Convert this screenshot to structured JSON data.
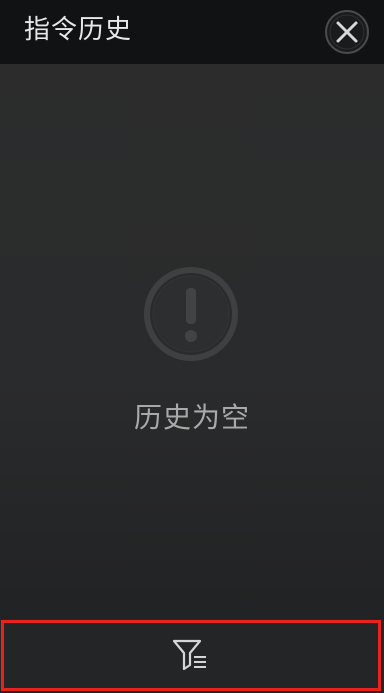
{
  "header": {
    "title": "指令历史",
    "close_icon": "close-icon"
  },
  "empty_state": {
    "icon": "exclamation-circle-icon",
    "message": "历史为空"
  },
  "bottom_bar": {
    "filter_icon": "filter-icon",
    "highlight_color": "#e8221c"
  },
  "colors": {
    "header_bg": "#111214",
    "body_bg": "#2b2c2d",
    "text_primary": "#e8e8e8",
    "text_secondary": "#a9a9a9",
    "icon_muted": "#3f4041"
  }
}
